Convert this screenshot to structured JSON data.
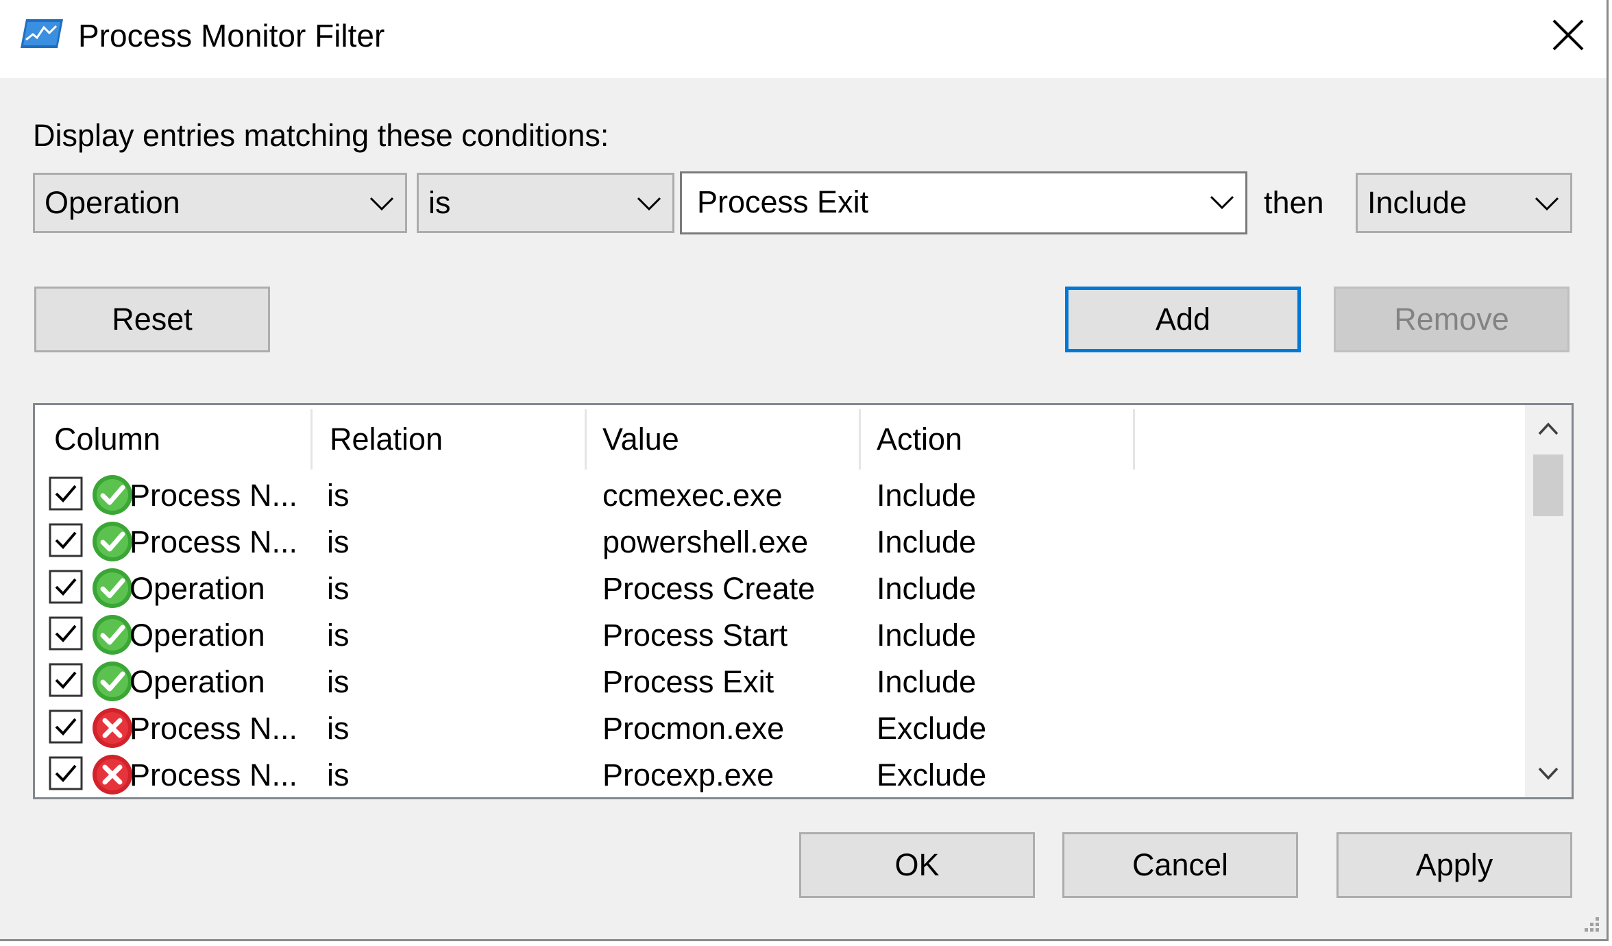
{
  "window": {
    "title": "Process Monitor Filter",
    "icon": "process-monitor-app-icon"
  },
  "condition": {
    "label": "Display entries matching these conditions:",
    "column_value": "Operation",
    "relation_value": "is",
    "value_text": "Process Exit",
    "then_label": "then",
    "action_value": "Include"
  },
  "buttons": {
    "reset": "Reset",
    "add": "Add",
    "remove": "Remove",
    "ok": "OK",
    "cancel": "Cancel",
    "apply": "Apply"
  },
  "table": {
    "headers": [
      "Column",
      "Relation",
      "Value",
      "Action"
    ],
    "rows": [
      {
        "checked": true,
        "status": "include",
        "column": "Process N...",
        "relation": "is",
        "value": "ccmexec.exe",
        "action": "Include"
      },
      {
        "checked": true,
        "status": "include",
        "column": "Process N...",
        "relation": "is",
        "value": "powershell.exe",
        "action": "Include"
      },
      {
        "checked": true,
        "status": "include",
        "column": "Operation",
        "relation": "is",
        "value": "Process Create",
        "action": "Include"
      },
      {
        "checked": true,
        "status": "include",
        "column": "Operation",
        "relation": "is",
        "value": "Process Start",
        "action": "Include"
      },
      {
        "checked": true,
        "status": "include",
        "column": "Operation",
        "relation": "is",
        "value": "Process Exit",
        "action": "Include"
      },
      {
        "checked": true,
        "status": "exclude",
        "column": "Process N...",
        "relation": "is",
        "value": "Procmon.exe",
        "action": "Exclude"
      },
      {
        "checked": true,
        "status": "exclude",
        "column": "Process N...",
        "relation": "is",
        "value": "Procexp.exe",
        "action": "Exclude"
      }
    ]
  },
  "colors": {
    "accent": "#0078d7",
    "include_green": "#3aa635",
    "exclude_red": "#d3222a"
  }
}
